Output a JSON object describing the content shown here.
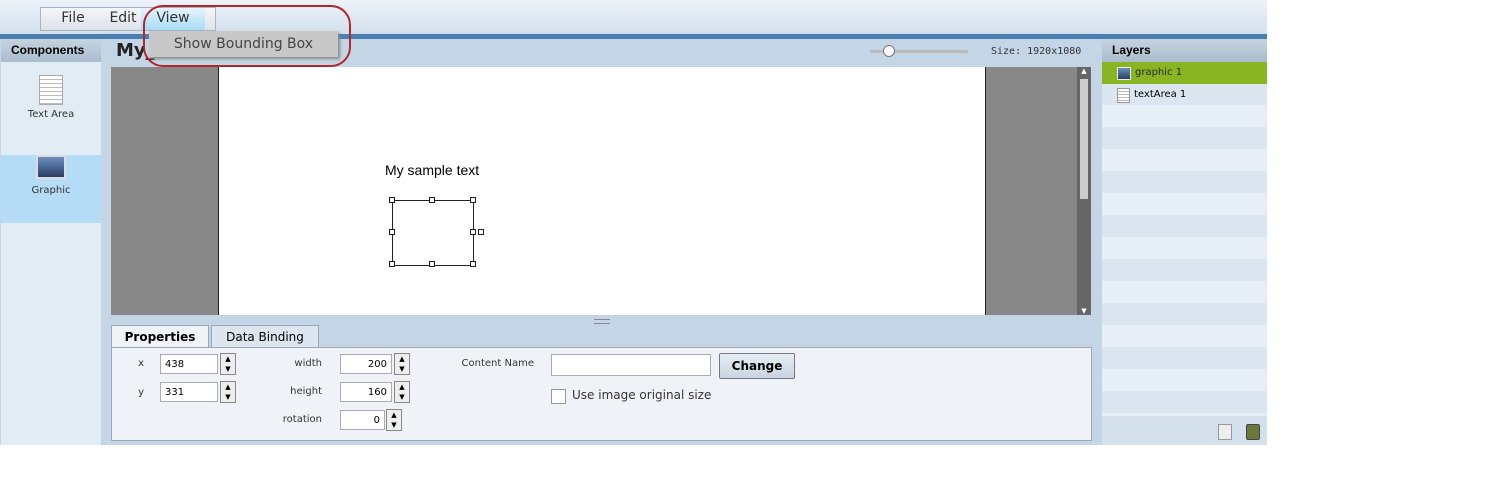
{
  "menu": {
    "items": [
      "File",
      "Edit",
      "View"
    ],
    "dropdown": [
      "Show Bounding Box"
    ]
  },
  "components": {
    "title": "Components",
    "items": [
      {
        "label": "Text Area",
        "icon": "text-area-icon"
      },
      {
        "label": "Graphic",
        "icon": "graphic-icon"
      }
    ]
  },
  "document": {
    "title": "My_",
    "size": "Size: 1920x1080",
    "zoom": 0.15,
    "sample_text": "My sample text"
  },
  "properties": {
    "tabs": [
      "Properties",
      "Data Binding"
    ],
    "x_label": "x",
    "x": "438",
    "y_label": "y",
    "y": "331",
    "width_label": "width",
    "width": "200",
    "height_label": "height",
    "height": "160",
    "rotation_label": "rotation",
    "rotation": "0",
    "content_name_label": "Content Name",
    "content_name": "",
    "change": "Change",
    "use_original": "Use image original size"
  },
  "layers": {
    "title": "Layers",
    "items": [
      "graphic 1",
      "textArea 1"
    ]
  },
  "colors": {
    "accent": "#4a7fb3",
    "selected_layer": "#8ab523",
    "highlight": "#b5252c"
  }
}
